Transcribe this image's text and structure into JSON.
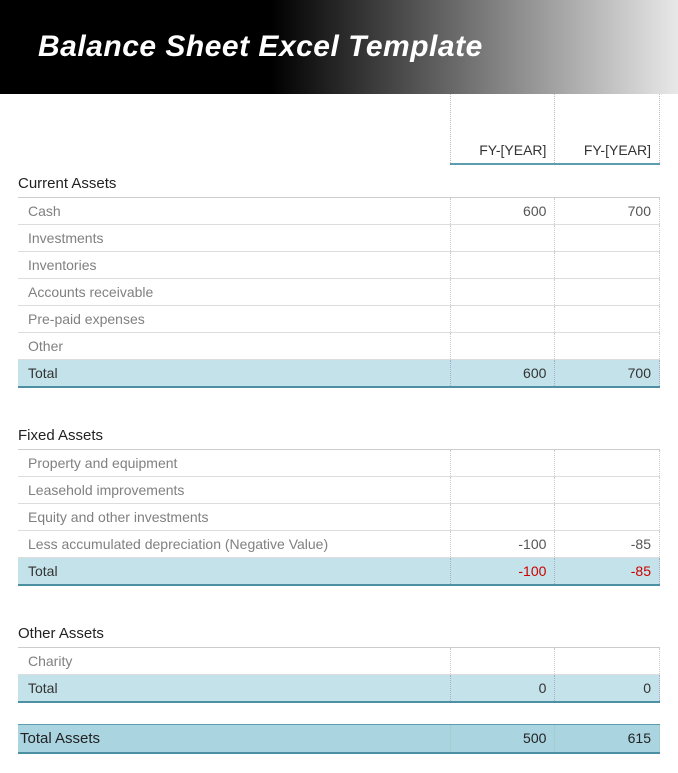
{
  "header": {
    "title": "Balance Sheet Excel Template"
  },
  "columns": {
    "y1": "FY-[YEAR]",
    "y2": "FY-[YEAR]"
  },
  "sections": [
    {
      "title": "Current Assets",
      "rows": [
        {
          "label": "Cash",
          "y1": "600",
          "y2": "700"
        },
        {
          "label": "Investments",
          "y1": "",
          "y2": ""
        },
        {
          "label": "Inventories",
          "y1": "",
          "y2": ""
        },
        {
          "label": "Accounts receivable",
          "y1": "",
          "y2": ""
        },
        {
          "label": "Pre-paid expenses",
          "y1": "",
          "y2": ""
        },
        {
          "label": "Other",
          "y1": "",
          "y2": ""
        }
      ],
      "total": {
        "label": "Total",
        "y1": "600",
        "y2": "700",
        "neg": false
      }
    },
    {
      "title": "Fixed Assets",
      "rows": [
        {
          "label": "Property and equipment",
          "y1": "",
          "y2": ""
        },
        {
          "label": "Leasehold improvements",
          "y1": "",
          "y2": ""
        },
        {
          "label": "Equity and other investments",
          "y1": "",
          "y2": ""
        },
        {
          "label": "Less accumulated depreciation (Negative Value)",
          "y1": "-100",
          "y2": "-85"
        }
      ],
      "total": {
        "label": "Total",
        "y1": "-100",
        "y2": "-85",
        "neg": true
      }
    },
    {
      "title": "Other Assets",
      "rows": [
        {
          "label": "Charity",
          "y1": "",
          "y2": ""
        }
      ],
      "total": {
        "label": "Total",
        "y1": "0",
        "y2": "0",
        "neg": false
      }
    }
  ],
  "grand_total": {
    "label": "Total Assets",
    "y1": "500",
    "y2": "615"
  }
}
